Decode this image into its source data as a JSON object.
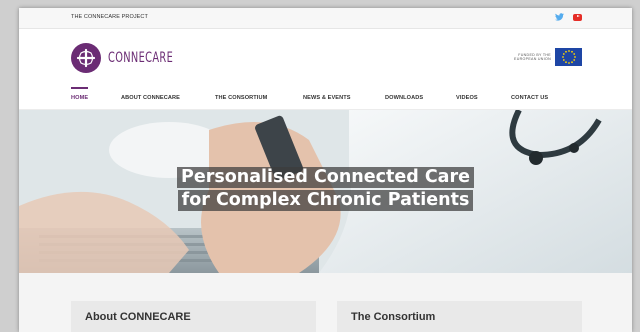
{
  "topbar": {
    "project_label": "THE CONNECARE PROJECT",
    "social_icons": [
      "twitter-icon",
      "youtube-icon"
    ]
  },
  "brand": {
    "logo_text": "CONNECARE",
    "logo_color": "#6b2c74"
  },
  "funding": {
    "line1": "FUNDED BY THE",
    "line2": "EUROPEAN UNION",
    "flag_color": "#1e46a5",
    "star_color": "#ffd500"
  },
  "nav": {
    "items": [
      {
        "label": "HOME",
        "active": true
      },
      {
        "label": "ABOUT CONNECARE"
      },
      {
        "label": "THE CONSORTIUM"
      },
      {
        "label": "NEWS & EVENTS"
      },
      {
        "label": "DOWNLOADS"
      },
      {
        "label": "VIDEOS"
      },
      {
        "label": "CONTACT US"
      }
    ]
  },
  "hero": {
    "title_line1": "Personalised Connected Care",
    "title_line2": "for Complex Chronic Patients"
  },
  "cards": [
    {
      "title": "About CONNECARE"
    },
    {
      "title": "The Consortium"
    }
  ]
}
